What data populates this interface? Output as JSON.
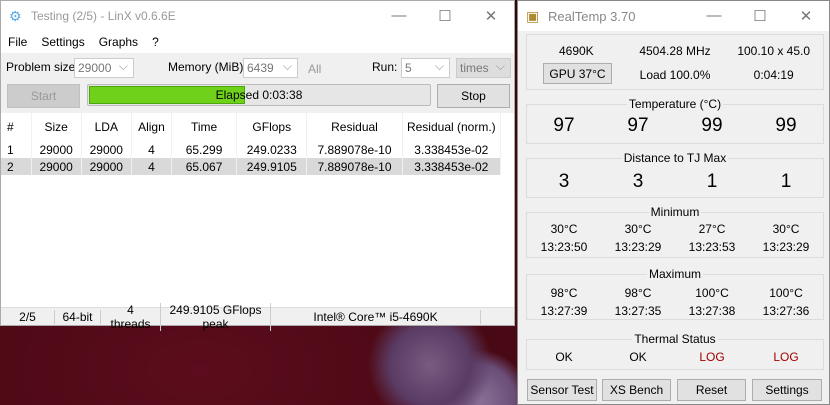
{
  "linx": {
    "title": "Testing (2/5) - LinX v0.6.6E",
    "menu": [
      "File",
      "Settings",
      "Graphs",
      "?"
    ],
    "problem_size_label": "Problem size:",
    "problem_size": "29000",
    "memory_label": "Memory (MiB):",
    "memory": "6439",
    "all_label": "All",
    "run_label": "Run:",
    "run": "5",
    "run_unit": "times",
    "start_label": "Start",
    "stop_label": "Stop",
    "progress_text": "Elapsed 0:03:38",
    "progress_fraction": 0.46,
    "columns": [
      "#",
      "Size",
      "LDA",
      "Align",
      "Time",
      "GFlops",
      "Residual",
      "Residual (norm.)"
    ],
    "rows": [
      [
        "1",
        "29000",
        "29000",
        "4",
        "65.299",
        "249.0233",
        "7.889078e-10",
        "3.338453e-02"
      ],
      [
        "2",
        "29000",
        "29000",
        "4",
        "65.067",
        "249.9105",
        "7.889078e-10",
        "3.338453e-02"
      ]
    ],
    "status": [
      "2/5",
      "64-bit",
      "4 threads",
      "249.9105 GFlops peak",
      "Intel® Core™ i5-4690K"
    ]
  },
  "realtemp": {
    "title": "RealTemp 3.70",
    "cpu": "4690K",
    "mhz": "4504.28 MHz",
    "mult": "100.10 x 45.0",
    "gpu": "GPU  37°C",
    "load": "Load 100.0%",
    "time": "0:04:19",
    "temp_label": "Temperature (°C)",
    "temps": [
      "97",
      "97",
      "99",
      "99"
    ],
    "dist_label": "Distance to TJ Max",
    "dist": [
      "3",
      "3",
      "1",
      "1"
    ],
    "min_label": "Minimum",
    "min_t": [
      "30°C",
      "30°C",
      "27°C",
      "30°C"
    ],
    "min_time": [
      "13:23:50",
      "13:23:29",
      "13:23:53",
      "13:23:29"
    ],
    "max_label": "Maximum",
    "max_t": [
      "98°C",
      "98°C",
      "100°C",
      "100°C"
    ],
    "max_time": [
      "13:27:39",
      "13:27:35",
      "13:27:38",
      "13:27:36"
    ],
    "thermal_label": "Thermal Status",
    "thermal": [
      "OK",
      "OK",
      "LOG",
      "LOG"
    ],
    "buttons": [
      "Sensor Test",
      "XS Bench",
      "Reset",
      "Settings"
    ]
  }
}
